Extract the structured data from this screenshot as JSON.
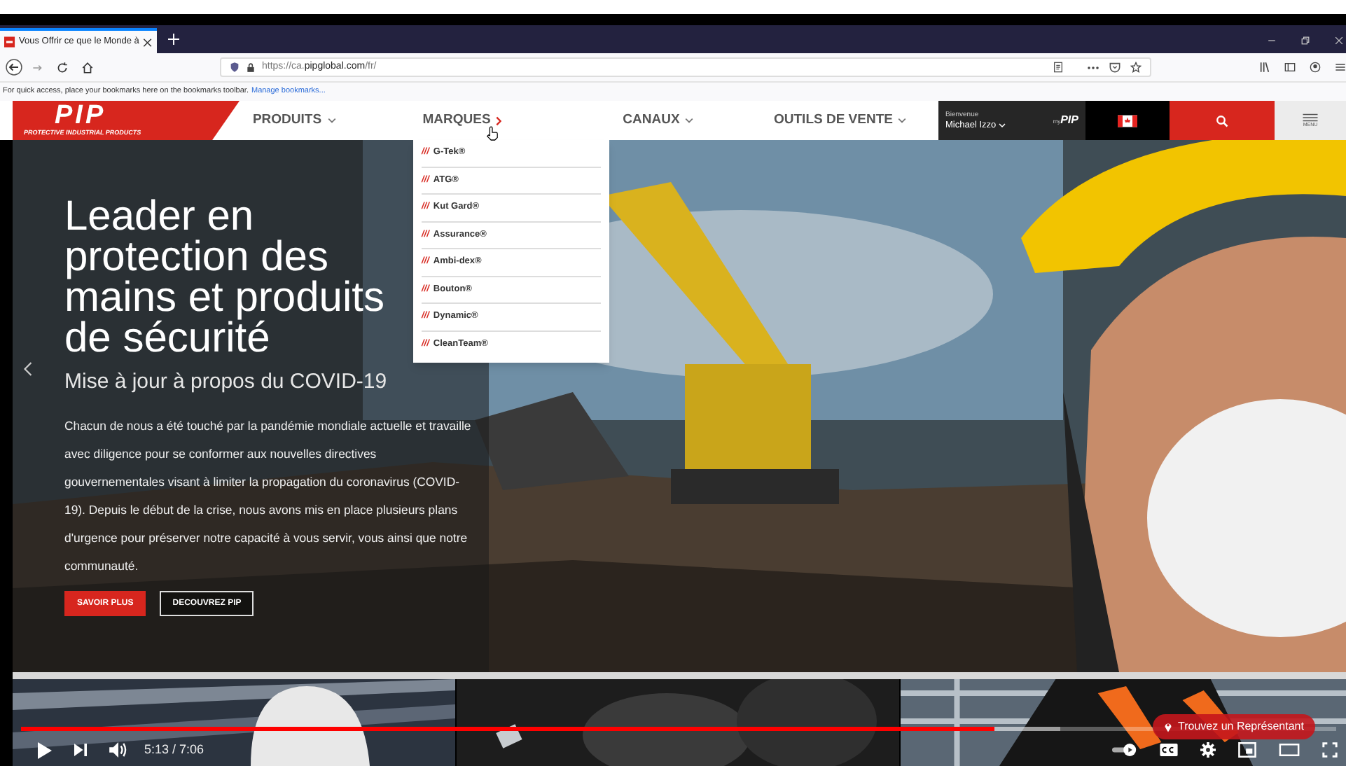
{
  "browser": {
    "tab_title": "Vous Offrir ce que le Monde à",
    "url": "https://ca.**pipglobal.com**/fr/",
    "bookmarks_hint": "For quick access, place your bookmarks here on the bookmarks toolbar.",
    "bookmarks_link": "Manage bookmarks..."
  },
  "site_header": {
    "logo": "PIP",
    "tagline": "PROTECTIVE INDUSTRIAL PRODUCTS",
    "nav": [
      {
        "label": "PRODUITS",
        "expanded": false
      },
      {
        "label": "MARQUES",
        "expanded": true
      },
      {
        "label": "CANAUX",
        "expanded": false
      },
      {
        "label": "OUTILS DE VENTE",
        "expanded": false
      }
    ],
    "welcome": "Bienvenue",
    "user": "Michael Izzo",
    "mypip_prefix": "my",
    "mypip_logo": "PIP",
    "menu_label": "MENU"
  },
  "brands_menu": [
    {
      "prefix": "///",
      "label": "G-Tek®"
    },
    {
      "prefix": "///",
      "label": "ATG®"
    },
    {
      "prefix": "///",
      "label": "Kut Gard®"
    },
    {
      "prefix": "///",
      "label": "Assurance®"
    },
    {
      "prefix": "///",
      "label": "Ambi-dex®"
    },
    {
      "prefix": "///",
      "label": "Bouton®"
    },
    {
      "prefix": "///",
      "label": "Dynamic®"
    },
    {
      "prefix": "///",
      "label": "CleanTeam®"
    }
  ],
  "hero": {
    "headline": "Leader en protection des mains et produits de sécurité",
    "subtitle": "Mise à jour à propos du COVID-19",
    "body": "Chacun de nous a été touché par la pandémie mondiale actuelle et travaille avec diligence pour se conformer aux nouvelles directives gouvernementales visant à limiter la propagation du coronavirus (COVID-19). Depuis le début de la crise, nous avons mis en place plusieurs plans d'urgence pour préserver notre capacité à vous servir, vous ainsi que notre communauté.",
    "buttons": [
      {
        "label": "SAVOIR PLUS",
        "kind": "primary"
      },
      {
        "label": "DECOUVREZ PIP",
        "kind": "outline"
      }
    ]
  },
  "video": {
    "level": 0.74,
    "time": "5:13 / 7:06",
    "cta": "Trouvez un Représentant"
  }
}
